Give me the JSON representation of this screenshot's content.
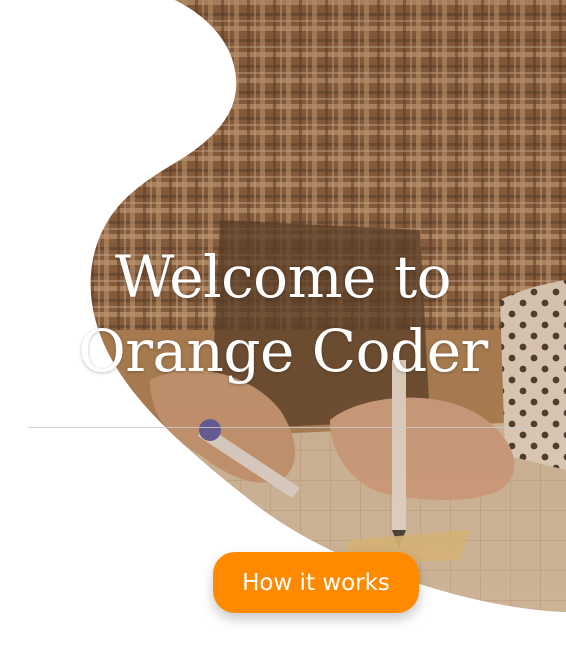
{
  "hero": {
    "title_line1": "Welcome to",
    "title_line2": "Orange Coder",
    "cta_label": "How it works",
    "background_image": "two-people-sketching-blueprint-photo"
  },
  "colors": {
    "accent": "#ff8a00",
    "photo_tint": "#a87a4e",
    "background": "#ffffff"
  }
}
